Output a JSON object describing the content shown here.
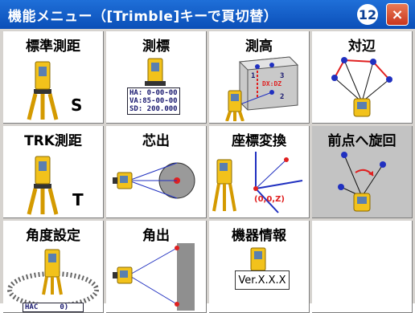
{
  "window": {
    "title": "機能メニュー（[Trimble]キーで頁切替）",
    "badge": "12",
    "close_label": "×"
  },
  "menu": [
    {
      "label": "標準測距",
      "letter": "S"
    },
    {
      "label": "測標",
      "readout": "HA: 0-00-00\nVA:85-00-00\nSD: 200.000"
    },
    {
      "label": "測高",
      "tag": "DX:DZ",
      "points": [
        "1",
        "3",
        "2"
      ]
    },
    {
      "label": "対辺"
    },
    {
      "label": "TRK測距",
      "letter": "T"
    },
    {
      "label": "芯出"
    },
    {
      "label": "座標変換",
      "coord": "(0,0,Z)"
    },
    {
      "label": "前点へ旋回",
      "selected": true
    },
    {
      "label": "角度設定",
      "readout": "HAC     0)"
    },
    {
      "label": "角出"
    },
    {
      "label": "機器情報",
      "version": "Ver.X.X.X"
    },
    {
      "label": ""
    }
  ]
}
